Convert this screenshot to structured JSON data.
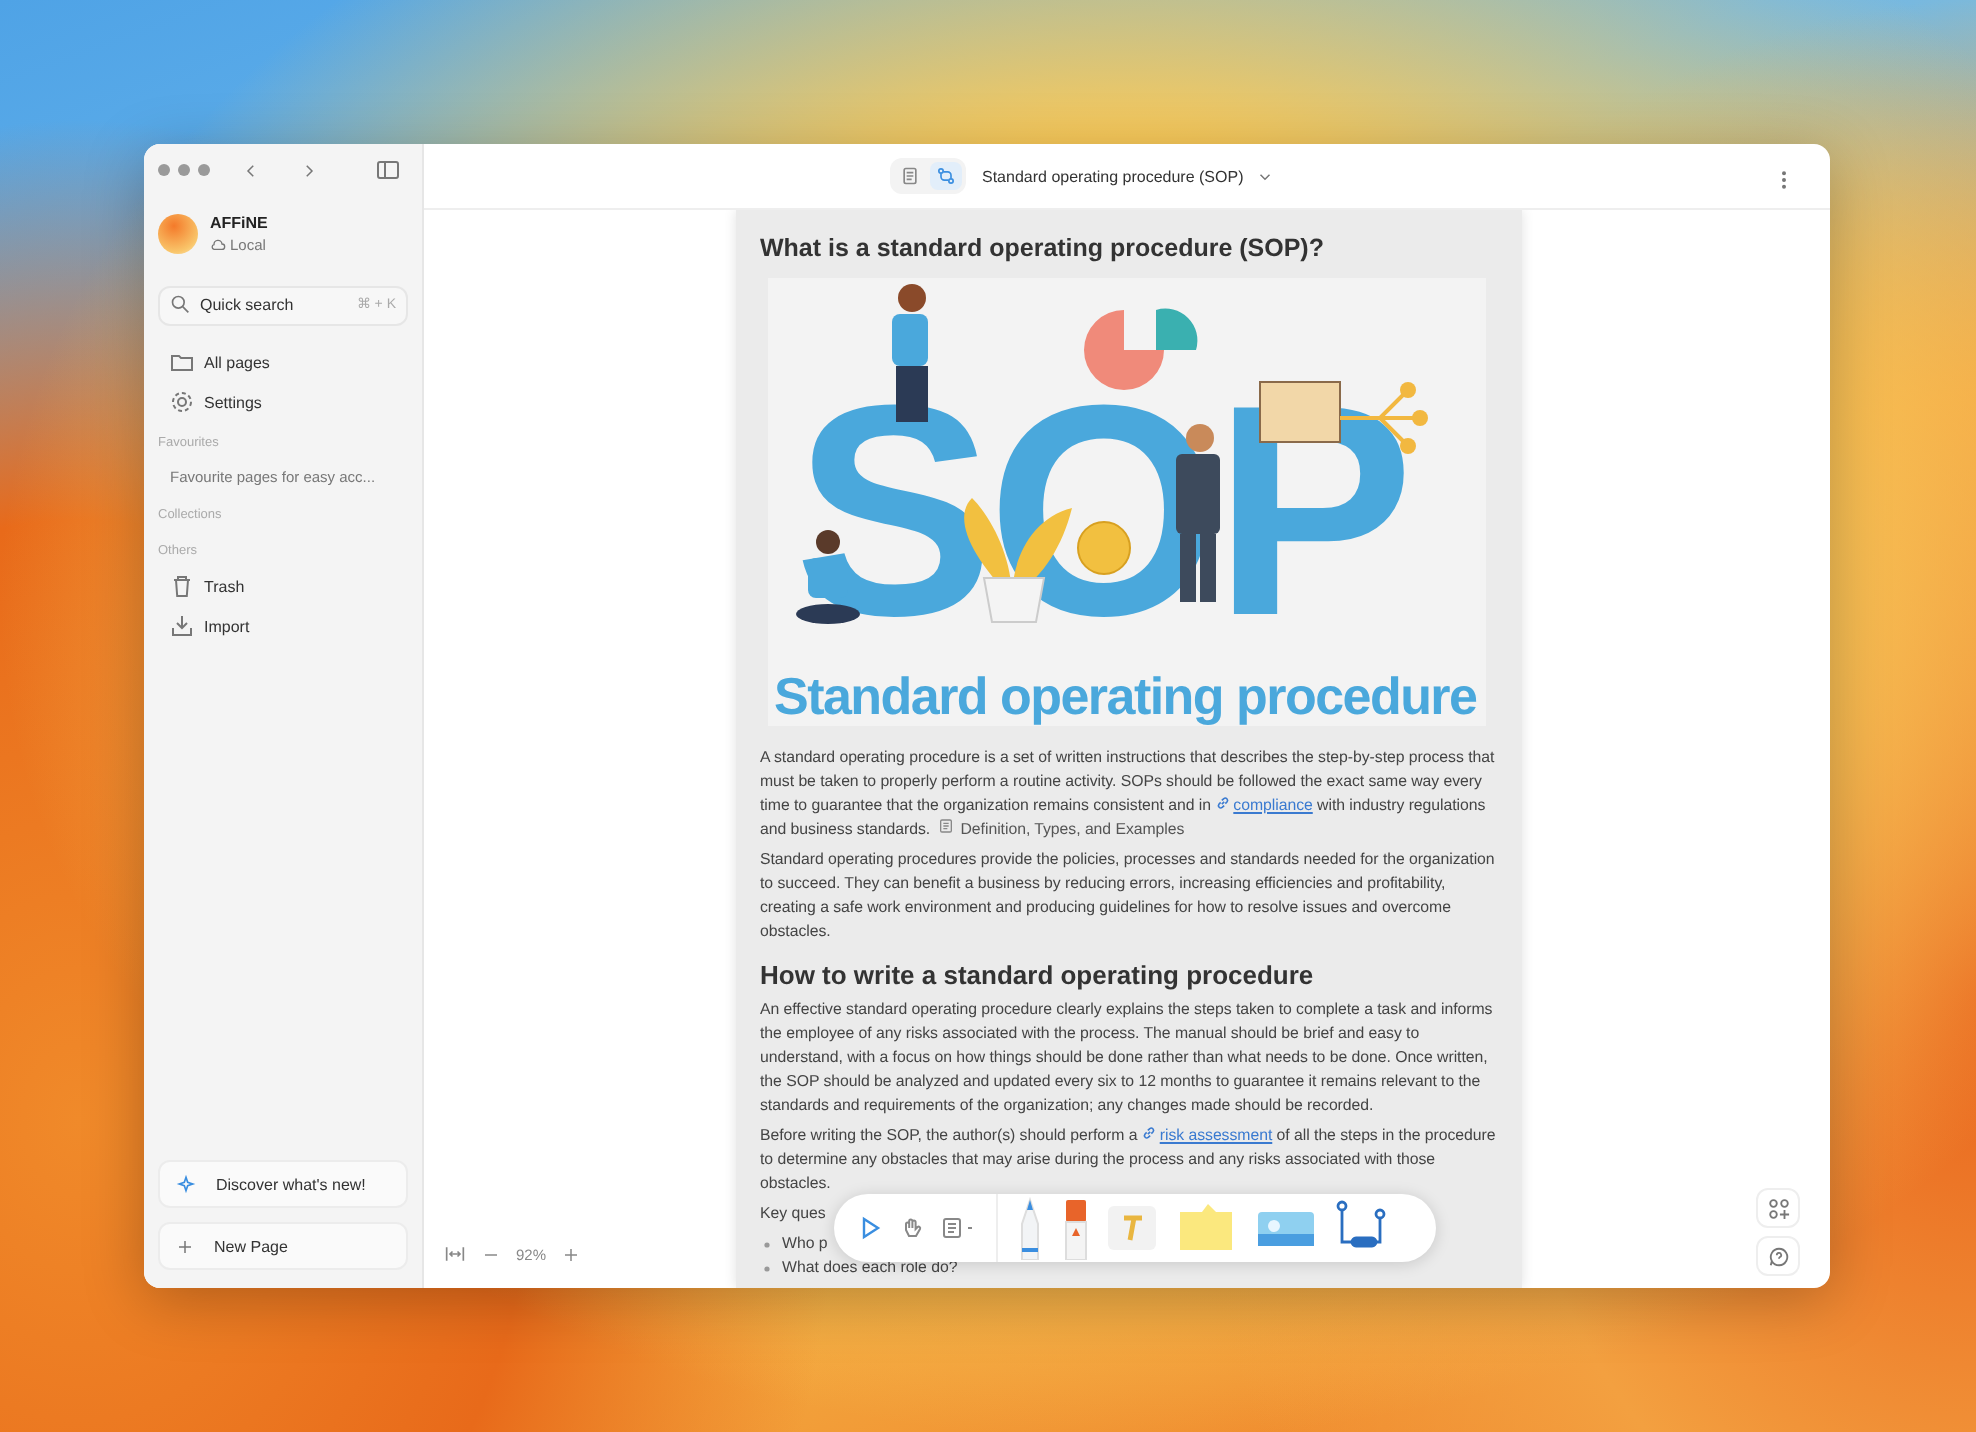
{
  "sidebar": {
    "workspace": {
      "name": "AFFiNE",
      "storage": "Local"
    },
    "search": {
      "placeholder": "Quick search",
      "shortcut": "⌘ + K"
    },
    "items": [
      {
        "kind": "nav",
        "label": "All pages"
      },
      {
        "kind": "nav",
        "label": "Settings"
      },
      {
        "kind": "heading",
        "label": "Favourites"
      },
      {
        "kind": "hint",
        "label": "Favourite pages for easy acc..."
      },
      {
        "kind": "heading",
        "label": "Collections"
      },
      {
        "kind": "heading",
        "label": "Others"
      },
      {
        "kind": "nav",
        "label": "Trash"
      },
      {
        "kind": "nav",
        "label": "Import"
      }
    ],
    "discover": "Discover what's new!",
    "new_page": "New Page"
  },
  "header": {
    "title": "Standard operating procedure (SOP)",
    "modes": [
      {
        "selected": false
      },
      {
        "selected": true
      }
    ]
  },
  "document": {
    "blocks": [
      {
        "kind": "h3",
        "text": "What is a standard operating procedure (SOP)?"
      },
      {
        "kind": "image",
        "letters": "SOP",
        "caption": "Standard operating procedure"
      },
      {
        "kind": "p",
        "parts": [
          {
            "kind": "text",
            "text": "A standard operating procedure is a set of written instructions that describes the step-by-step process that must be taken to properly perform a routine activity. SOPs should be followed the exact same way every time to guarantee that the organization remains consistent and in "
          },
          {
            "kind": "link",
            "text": "compliance"
          },
          {
            "kind": "text",
            "text": " with industry regulations and business standards. "
          },
          {
            "kind": "ref",
            "text": "Definition, Types, and Examples"
          }
        ]
      },
      {
        "kind": "p",
        "parts": [
          {
            "kind": "text",
            "text": "Standard operating procedures provide the policies, processes and standards needed for the organization to succeed. They can benefit a business by reducing errors, increasing efficiencies and profitability, creating a safe work environment and producing guidelines for how to resolve issues and overcome obstacles."
          }
        ]
      },
      {
        "kind": "h2",
        "text": "How to write a standard operating procedure"
      },
      {
        "kind": "p",
        "parts": [
          {
            "kind": "text",
            "text": "An effective standard operating procedure clearly explains the steps taken to complete a task and informs the employee of any risks associated with the process. The manual should be brief and easy to understand, with a focus on how things should be done rather than what needs to be done. Once written, the SOP should be analyzed and updated every six to 12 months to guarantee it remains relevant to the standards and requirements of the organization; any changes made should be recorded."
          }
        ]
      },
      {
        "kind": "p",
        "parts": [
          {
            "kind": "text",
            "text": "Before writing the SOP, the author(s) should perform a "
          },
          {
            "kind": "link",
            "text": "risk assessment"
          },
          {
            "kind": "text",
            "text": " of all the steps in the procedure to determine any obstacles that may arise during the process and any risks associated with those obstacles."
          }
        ]
      },
      {
        "kind": "p",
        "parts": [
          {
            "kind": "text",
            "text": "Key ques"
          }
        ]
      },
      {
        "kind": "bullet",
        "text": "Who p"
      },
      {
        "kind": "bullet",
        "text": "What does each role do?"
      }
    ]
  },
  "zoom": {
    "value": "92%"
  }
}
